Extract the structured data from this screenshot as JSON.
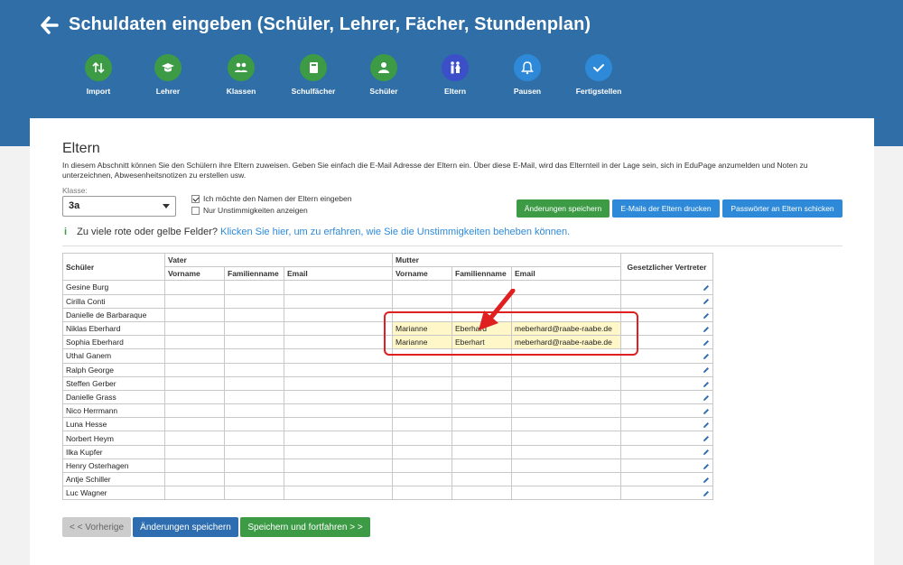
{
  "header": {
    "title": "Schuldaten eingeben (Schüler, Lehrer, Fächer, Stundenplan)"
  },
  "steps": [
    {
      "label": "Import",
      "icon": "import-icon",
      "color": "#3d9b46"
    },
    {
      "label": "Lehrer",
      "icon": "graduation-cap-icon",
      "color": "#3d9b46"
    },
    {
      "label": "Klassen",
      "icon": "group-icon",
      "color": "#3d9b46"
    },
    {
      "label": "Schulfächer",
      "icon": "book-icon",
      "color": "#3d9b46"
    },
    {
      "label": "Schüler",
      "icon": "person-icon",
      "color": "#3d9b46"
    },
    {
      "label": "Eltern",
      "icon": "parents-icon",
      "color": "#3b4fc8"
    },
    {
      "label": "Pausen",
      "icon": "bell-icon",
      "color": "#2e8ad8"
    },
    {
      "label": "Fertigstellen",
      "icon": "check-icon",
      "color": "#2e8ad8"
    }
  ],
  "section": {
    "title": "Eltern",
    "description": "In diesem Abschnitt können Sie den Schülern ihre Eltern zuweisen. Geben Sie einfach die E-Mail Adresse der Eltern ein. Über diese E-Mail, wird das Elternteil in der Lage sein, sich in EduPage anzumelden und Noten zu unterzeichnen, Abwesenheitsnotizen zu erstellen usw.",
    "klasse_label": "Klasse:",
    "klasse_value": "3a",
    "checkbox_names": "Ich möchte den Namen der Eltern eingeben",
    "checkbox_conflicts": "Nur Unstimmigkeiten anzeigen"
  },
  "toolbar": {
    "save": "Änderungen speichern",
    "print_emails": "E-Mails der Eltern drucken",
    "send_passwords": "Passwörter an Eltern schicken"
  },
  "info": {
    "icon": "i",
    "text": "Zu viele rote oder gelbe Felder?",
    "link": "Klicken Sie hier, um zu erfahren, wie Sie die Unstimmigkeiten beheben können."
  },
  "table": {
    "headers": {
      "student": "Schüler",
      "father": "Vater",
      "mother": "Mutter",
      "firstname": "Vorname",
      "lastname": "Familienname",
      "email": "Email",
      "guardian": "Gesetzlicher Vertreter"
    },
    "rows": [
      {
        "student": "Gesine Burg",
        "fv": "",
        "fl": "",
        "fe": "",
        "mv": "",
        "ml": "",
        "me": ""
      },
      {
        "student": "Cirilla Conti",
        "fv": "",
        "fl": "",
        "fe": "",
        "mv": "",
        "ml": "",
        "me": ""
      },
      {
        "student": "Danielle de Barbaraque",
        "fv": "",
        "fl": "",
        "fe": "",
        "mv": "",
        "ml": "",
        "me": ""
      },
      {
        "student": "Niklas Eberhard",
        "fv": "",
        "fl": "",
        "fe": "",
        "mv": "Marianne",
        "ml": "Eberhard",
        "me": "meberhard@raabe-raabe.de"
      },
      {
        "student": "Sophia Eberhard",
        "fv": "",
        "fl": "",
        "fe": "",
        "mv": "Marianne",
        "ml": "Eberhart",
        "me": "meberhard@raabe-raabe.de"
      },
      {
        "student": "Uthal Ganem",
        "fv": "",
        "fl": "",
        "fe": "",
        "mv": "",
        "ml": "",
        "me": ""
      },
      {
        "student": "Ralph George",
        "fv": "",
        "fl": "",
        "fe": "",
        "mv": "",
        "ml": "",
        "me": ""
      },
      {
        "student": "Steffen Gerber",
        "fv": "",
        "fl": "",
        "fe": "",
        "mv": "",
        "ml": "",
        "me": ""
      },
      {
        "student": "Danielle Grass",
        "fv": "",
        "fl": "",
        "fe": "",
        "mv": "",
        "ml": "",
        "me": ""
      },
      {
        "student": "Nico Herrmann",
        "fv": "",
        "fl": "",
        "fe": "",
        "mv": "",
        "ml": "",
        "me": ""
      },
      {
        "student": "Luna Hesse",
        "fv": "",
        "fl": "",
        "fe": "",
        "mv": "",
        "ml": "",
        "me": ""
      },
      {
        "student": "Norbert Heym",
        "fv": "",
        "fl": "",
        "fe": "",
        "mv": "",
        "ml": "",
        "me": ""
      },
      {
        "student": "Ilka Kupfer",
        "fv": "",
        "fl": "",
        "fe": "",
        "mv": "",
        "ml": "",
        "me": ""
      },
      {
        "student": "Henry Osterhagen",
        "fv": "",
        "fl": "",
        "fe": "",
        "mv": "",
        "ml": "",
        "me": ""
      },
      {
        "student": "Antje Schiller",
        "fv": "",
        "fl": "",
        "fe": "",
        "mv": "",
        "ml": "",
        "me": ""
      },
      {
        "student": "Luc Wagner",
        "fv": "",
        "fl": "",
        "fe": "",
        "mv": "",
        "ml": "",
        "me": ""
      }
    ]
  },
  "footer": {
    "prev": "< < Vorherige",
    "save": "Änderungen speichern",
    "save_continue": "Speichern und fortfahren > >"
  },
  "colors": {
    "header_bg": "#2f6ea6",
    "green": "#3d9b46",
    "blue": "#2e8ad8",
    "highlight": "#fff7c8",
    "annotation": "#e02020"
  }
}
